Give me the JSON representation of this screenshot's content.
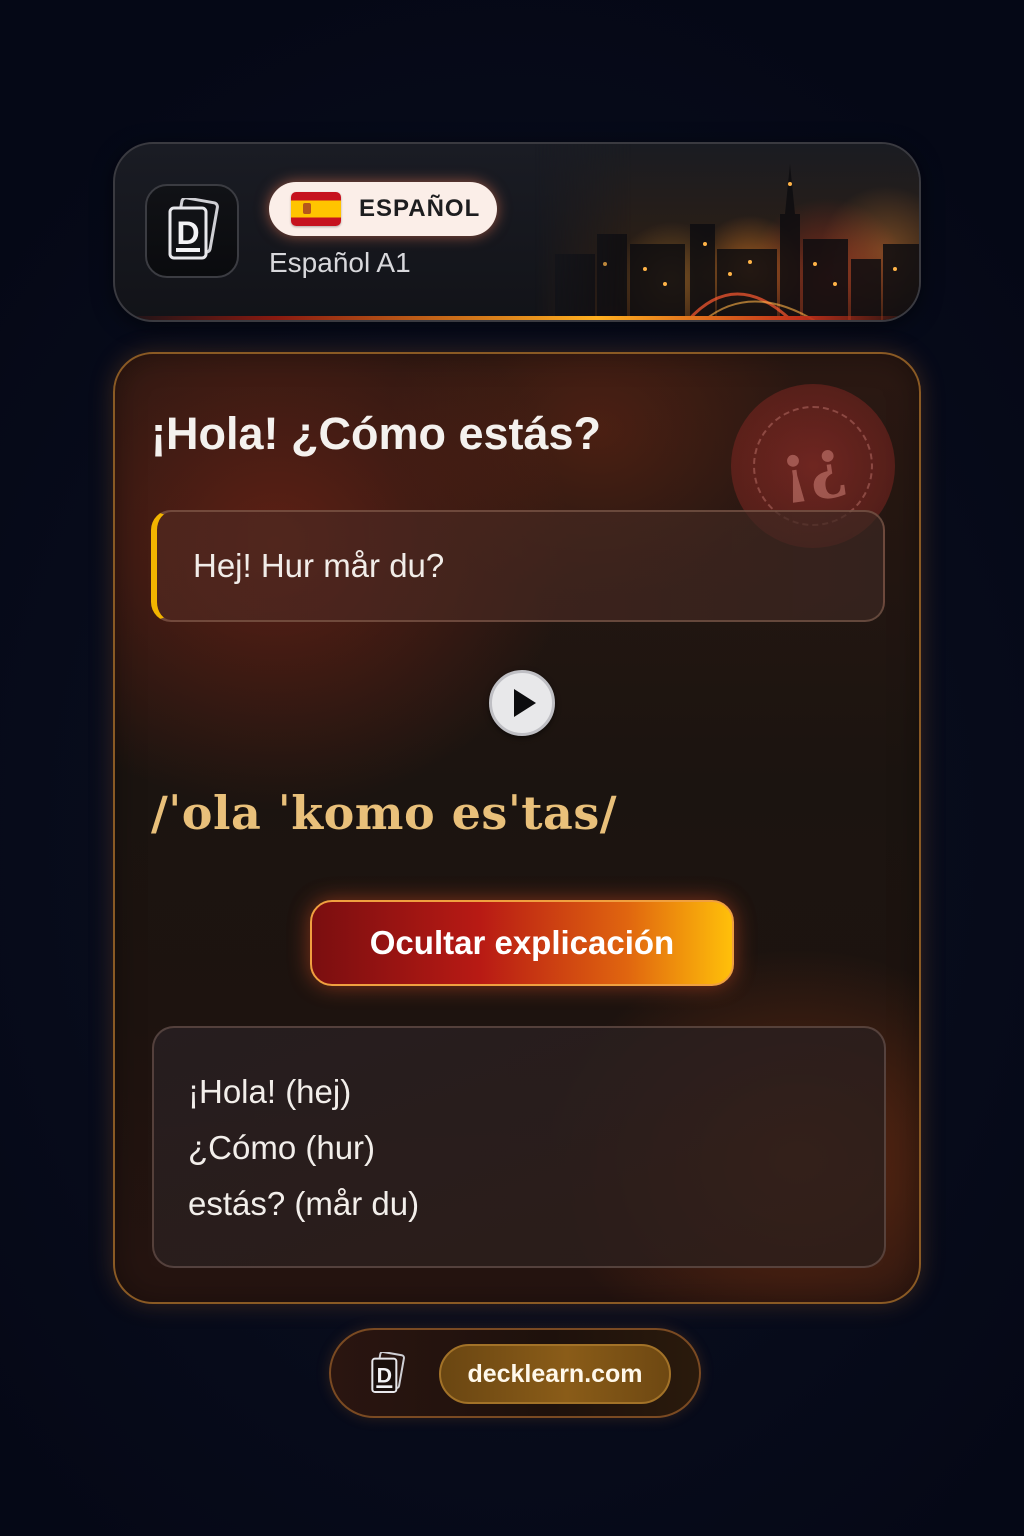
{
  "header": {
    "language_label": "ESPAÑOL",
    "level_label": "Español A1",
    "flag_icon": "spain-flag-icon",
    "logo_icon": "decklearn-logo-icon"
  },
  "card": {
    "phrase": "¡Hola! ¿Cómo estás?",
    "translation": "Hej! Hur mår du?",
    "watermark_glyph": "¡¿",
    "play_icon": "play-icon",
    "ipa": "/ˈola ˈkomo esˈtas/",
    "toggle_button_label": "Ocultar explicación",
    "explanation_lines": [
      "¡Hola! (hej)",
      "¿Cómo (hur)",
      "estás? (mår du)"
    ]
  },
  "footer": {
    "site_label": "decklearn.com",
    "logo_icon": "decklearn-logo-icon"
  },
  "colors": {
    "background": "#070b1a",
    "accent_gold": "#f2b400",
    "ipa_gold": "#e9c07a",
    "button_red": "#b81a14",
    "button_yellow": "#ffc00a"
  }
}
